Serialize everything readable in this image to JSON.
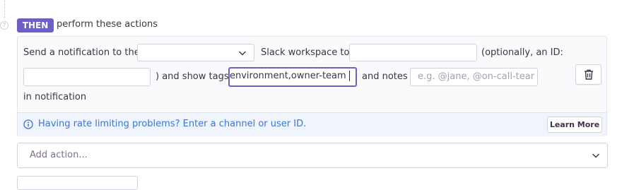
{
  "header": {
    "then_badge": "THEN",
    "then_text": "perform these actions"
  },
  "action": {
    "send_label": "Send a notification to the",
    "workspace_select_value": "",
    "workspace_label": "Slack workspace to",
    "channel_value": "",
    "optional_id_label": "(optionally, an ID:",
    "id_value": "",
    "show_tags_label": ") and show tags",
    "tags_value": "environment,owner-team",
    "notes_label": "and notes",
    "notes_placeholder": "e.g. @jane, @on-call-tear",
    "in_notification_label": "in notification"
  },
  "alert": {
    "text": "Having rate limiting problems? Enter a channel or user ID.",
    "button": "Learn More"
  },
  "add_action": {
    "placeholder": "Add action..."
  },
  "colors": {
    "accent": "#6c5fc7",
    "info_text": "#3d74db",
    "info_bg": "#f0f4fd"
  }
}
